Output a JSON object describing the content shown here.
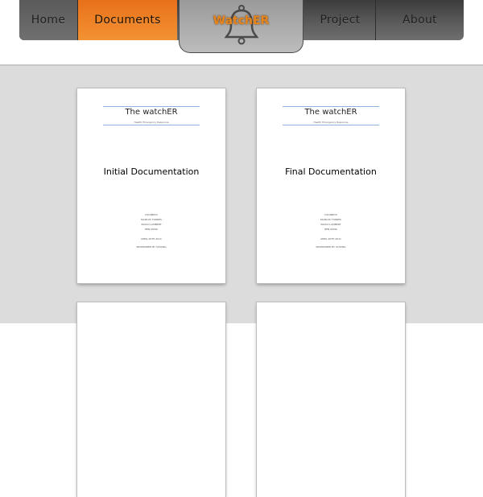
{
  "nav": {
    "home": "Home",
    "documents": "Documents",
    "logo": "WatchER",
    "project": "Project",
    "about": "About"
  },
  "documents": [
    {
      "title": "The watchER",
      "subtitle": "Health Emergency Response",
      "heading": "Initial Documentation",
      "team": [
        "CSC4BP15",
        "MARCUS TORRES",
        "PAOLO LAMBERT",
        "REN KUNG"
      ],
      "date": "APRIL 20TH 2011",
      "sponsor": "SPONSORED BY SCSCNG"
    },
    {
      "title": "The watchER",
      "subtitle": "Health Emergency Response",
      "heading": "Final Documentation",
      "team": [
        "CSC4BP15",
        "MARCUS TORRES",
        "PAOLO LAMBERT",
        "REN KUNG"
      ],
      "date": "APRIL 20TH 2011",
      "sponsor": "SPONSORED BY SCSCNG"
    }
  ],
  "colors": {
    "active_tab": "#f08a2a",
    "logo_text": "#e8861e",
    "background": "#dcdcdc"
  }
}
